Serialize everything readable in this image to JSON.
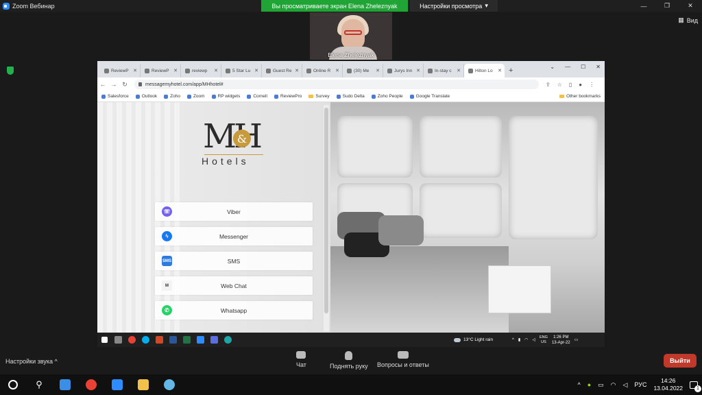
{
  "zoom": {
    "window_title": "Zoom Вебинар",
    "share_banner": "Вы просматриваете экран Elena Zheleznyak",
    "view_settings": "Настройки просмотра",
    "view_button": "Вид",
    "participant_name": "Elena Zheleznyak",
    "sound_settings": "Настройки звука",
    "toolbar": {
      "chat": "Чат",
      "raise_hand": "Поднять руку",
      "qa": "Вопросы и ответы",
      "exit": "Выйти"
    }
  },
  "browser": {
    "tabs": [
      {
        "label": "ReviewP"
      },
      {
        "label": "ReviewP"
      },
      {
        "label": "reviewp"
      },
      {
        "label": "5 Star Lu"
      },
      {
        "label": "Guest Re"
      },
      {
        "label": "Online R"
      },
      {
        "label": "(30) Me"
      },
      {
        "label": "Jurys Inn"
      },
      {
        "label": "In-stay c"
      },
      {
        "label": "Hilton Lo"
      }
    ],
    "url": "messagemyhotel.com/app/MHhotel#",
    "bookmarks": [
      "Salesforce",
      "Outlook",
      "Zoho",
      "Zoom",
      "RP widgets",
      "Cornell",
      "ReviewPro",
      "Survey",
      "Sudo Delta",
      "Zoho People",
      "Google Translate"
    ],
    "other_bookmarks": "Other bookmarks"
  },
  "page": {
    "logo_mark": "MH",
    "logo_amp": "&",
    "logo_text": "Hotels",
    "buttons": [
      {
        "label": "Viber",
        "icon": "viber-icon"
      },
      {
        "label": "Messenger",
        "icon": "messenger-icon"
      },
      {
        "label": "SMS",
        "icon": "sms-icon",
        "icon_text": "SMS"
      },
      {
        "label": "Web Chat",
        "icon": "webchat-icon",
        "icon_text": "M"
      },
      {
        "label": "Whatsapp",
        "icon": "whatsapp-icon"
      }
    ]
  },
  "remote_taskbar": {
    "weather": "13°C  Light rain",
    "lang_top": "ENG",
    "lang_bottom": "US",
    "time": "1:26 PM",
    "date": "13-Apr-22"
  },
  "taskbar": {
    "lang": "РУС",
    "time": "14:26",
    "date": "13.04.2022",
    "notifications": "1"
  },
  "colors": {
    "zoom_green": "#21a436",
    "exit_red": "#c0392b",
    "logo_gold": "#c79a3c"
  }
}
